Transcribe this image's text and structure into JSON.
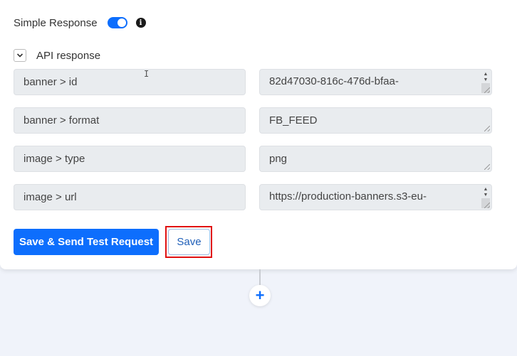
{
  "settings": {
    "simple_response_label": "Simple Response",
    "simple_response_enabled": true,
    "info_icon": "info-circle-icon",
    "api_response_label": "API response",
    "api_response_expanded": true
  },
  "mappings": [
    {
      "key": "banner > id",
      "value": "82d47030-816c-476d-bfaa-"
    },
    {
      "key": "banner > format",
      "value": "FB_FEED"
    },
    {
      "key": "image > type",
      "value": "png"
    },
    {
      "key": "image > url",
      "value": "https://production-banners.s3-eu-"
    }
  ],
  "actions": {
    "save_send_label": "Save & Send Test Request",
    "save_label": "Save"
  },
  "flow": {
    "add_step_symbol": "+"
  },
  "colors": {
    "primary": "#0d6efd",
    "highlight": "#e01010",
    "background": "#f0f3fa"
  }
}
